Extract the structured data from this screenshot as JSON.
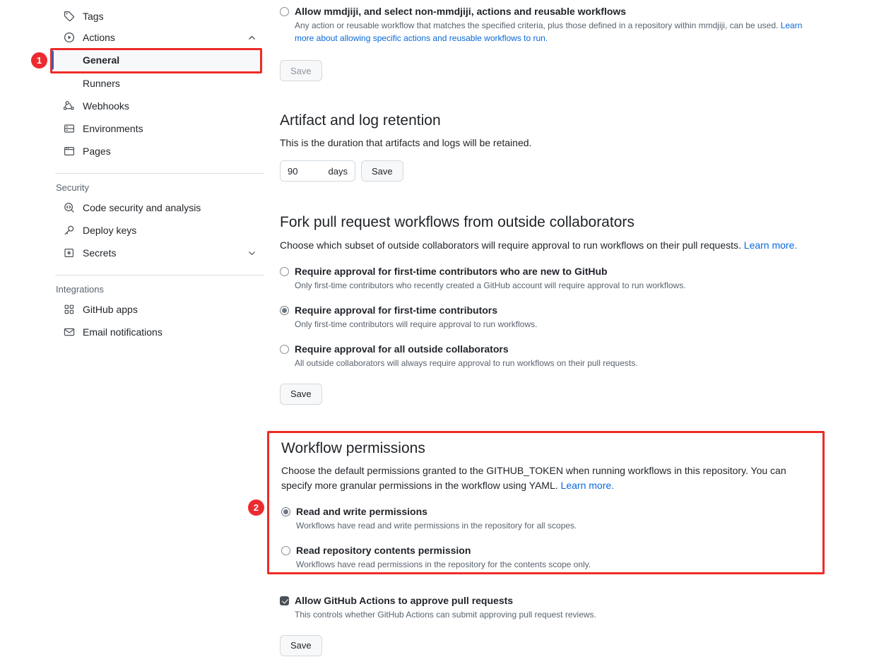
{
  "sidebar": {
    "items": [
      {
        "label": "Tags",
        "icon": "tag-icon",
        "type": "item"
      },
      {
        "label": "Actions",
        "icon": "play-circle-icon",
        "type": "item",
        "expanded": true,
        "chevron": "chevron-up-icon"
      },
      {
        "label": "General",
        "type": "sub",
        "selected": true
      },
      {
        "label": "Runners",
        "type": "sub",
        "selected": false
      },
      {
        "label": "Webhooks",
        "icon": "webhook-icon",
        "type": "item"
      },
      {
        "label": "Environments",
        "icon": "server-icon",
        "type": "item"
      },
      {
        "label": "Pages",
        "icon": "browser-icon",
        "type": "item"
      }
    ],
    "security_section": {
      "title": "Security",
      "items": [
        {
          "label": "Code security and analysis",
          "icon": "code-search-icon"
        },
        {
          "label": "Deploy keys",
          "icon": "key-icon"
        },
        {
          "label": "Secrets",
          "icon": "asterisk-box-icon",
          "chevron": "chevron-down-icon"
        }
      ]
    },
    "integrations_section": {
      "title": "Integrations",
      "items": [
        {
          "label": "GitHub apps",
          "icon": "apps-grid-icon"
        },
        {
          "label": "Email notifications",
          "icon": "mail-icon"
        }
      ]
    }
  },
  "allowed_actions": {
    "option_label": "Allow mmdjiji, and select non-mmdjiji, actions and reusable workflows",
    "help_text": "Any action or reusable workflow that matches the specified criteria, plus those defined in a repository within mmdjiji, can be used. ",
    "help_link": "Learn more about allowing specific actions and reusable workflows to run.",
    "selected": false,
    "save_label": "Save",
    "save_disabled": true
  },
  "artifact_retention": {
    "heading": "Artifact and log retention",
    "description": "This is the duration that artifacts and logs will be retained.",
    "value": "90",
    "unit": "days",
    "save_label": "Save"
  },
  "fork_pr_workflows": {
    "heading": "Fork pull request workflows from outside collaborators",
    "description": "Choose which subset of outside collaborators will require approval to run workflows on their pull requests. ",
    "description_link": "Learn more.",
    "options": [
      {
        "label": "Require approval for first-time contributors who are new to GitHub",
        "help": "Only first-time contributors who recently created a GitHub account will require approval to run workflows.",
        "selected": false
      },
      {
        "label": "Require approval for first-time contributors",
        "help": "Only first-time contributors will require approval to run workflows.",
        "selected": true
      },
      {
        "label": "Require approval for all outside collaborators",
        "help": "All outside collaborators will always require approval to run workflows on their pull requests.",
        "selected": false
      }
    ],
    "save_label": "Save"
  },
  "workflow_permissions": {
    "heading": "Workflow permissions",
    "description": "Choose the default permissions granted to the GITHUB_TOKEN when running workflows in this repository. You can specify more granular permissions in the workflow using YAML. ",
    "description_link": "Learn more.",
    "options": [
      {
        "label": "Read and write permissions",
        "help": "Workflows have read and write permissions in the repository for all scopes.",
        "selected": true
      },
      {
        "label": "Read repository contents permission",
        "help": "Workflows have read permissions in the repository for the contents scope only.",
        "selected": false
      }
    ]
  },
  "approve_pull_requests": {
    "label": "Allow GitHub Actions to approve pull requests",
    "help": "This controls whether GitHub Actions can submit approving pull request reviews.",
    "checked": true,
    "save_label": "Save"
  },
  "annotations": {
    "badge_1": "1",
    "badge_2": "2",
    "highlight_color": "#ee2b27"
  }
}
